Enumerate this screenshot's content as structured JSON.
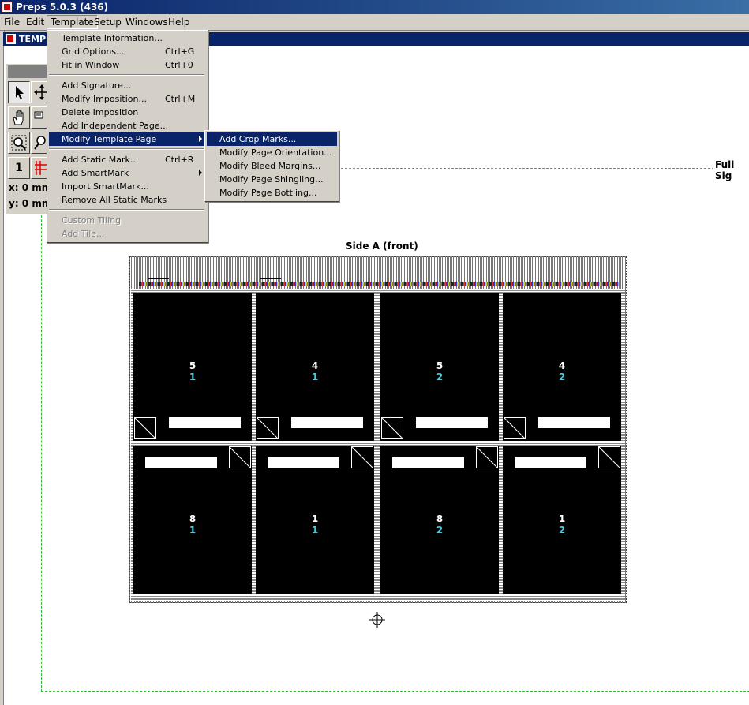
{
  "app": {
    "title": "Preps 5.0.3 (436)"
  },
  "menubar": {
    "items": [
      "File",
      "Edit",
      "Template",
      "Setup",
      "Windows",
      "Help"
    ]
  },
  "document": {
    "title": "TEMPL"
  },
  "toolbox": {
    "x_readout": "x: 0 mm",
    "y_readout": "y: 0 mm",
    "page_number": "1"
  },
  "template_menu": {
    "items": [
      {
        "label": "Template Information...",
        "shortcut": ""
      },
      {
        "label": "Grid Options...",
        "shortcut": "Ctrl+G"
      },
      {
        "label": "Fit in Window",
        "shortcut": "Ctrl+0"
      },
      {
        "label": "Add Signature...",
        "shortcut": ""
      },
      {
        "label": "Modify Imposition...",
        "shortcut": "Ctrl+M"
      },
      {
        "label": "Delete Imposition",
        "shortcut": ""
      },
      {
        "label": "Add Independent Page...",
        "shortcut": ""
      },
      {
        "label": "Modify Template Page",
        "shortcut": ""
      },
      {
        "label": "Add Static Mark...",
        "shortcut": "Ctrl+R"
      },
      {
        "label": "Add SmartMark",
        "shortcut": ""
      },
      {
        "label": "Import SmartMark...",
        "shortcut": ""
      },
      {
        "label": "Remove All Static Marks",
        "shortcut": ""
      },
      {
        "label": "Custom Tiling",
        "shortcut": ""
      },
      {
        "label": "Add Tile...",
        "shortcut": ""
      }
    ]
  },
  "submenu": {
    "items": [
      {
        "label": "Add Crop Marks..."
      },
      {
        "label": "Modify Page Orientation..."
      },
      {
        "label": "Modify Bleed Margins..."
      },
      {
        "label": "Modify Page Shingling..."
      },
      {
        "label": "Modify Page Bottling..."
      }
    ]
  },
  "canvas": {
    "signature_label": "Full Sig",
    "side_label": "Side A (front)",
    "pages": [
      {
        "folio": "5",
        "signature": "1"
      },
      {
        "folio": "4",
        "signature": "1"
      },
      {
        "folio": "5",
        "signature": "2"
      },
      {
        "folio": "4",
        "signature": "2"
      },
      {
        "folio": "8",
        "signature": "1"
      },
      {
        "folio": "1",
        "signature": "1"
      },
      {
        "folio": "8",
        "signature": "2"
      },
      {
        "folio": "1",
        "signature": "2"
      }
    ]
  },
  "colors": {
    "menu_highlight": "#0a246a",
    "signature_border": "#2fbe2f",
    "signature_number": "#3fd0e0"
  }
}
